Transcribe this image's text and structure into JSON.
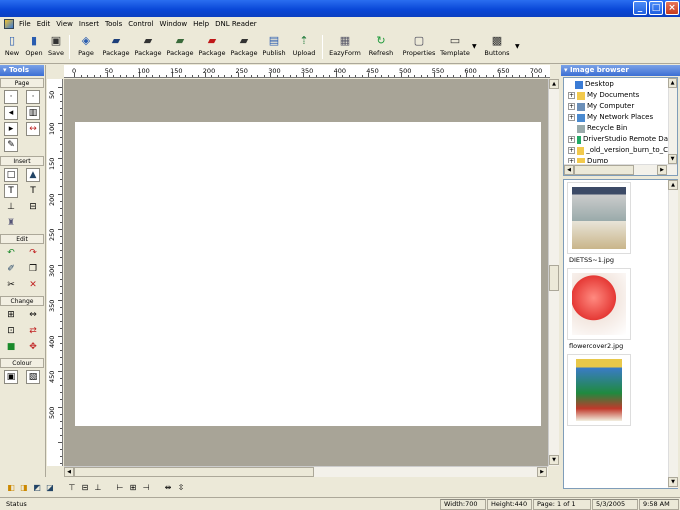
{
  "menu": [
    "File",
    "Edit",
    "View",
    "Insert",
    "Tools",
    "Control",
    "Window",
    "Help",
    "DNL Reader"
  ],
  "toolbar": {
    "items": [
      {
        "label": "New",
        "icon": "new-document-icon"
      },
      {
        "label": "Open",
        "icon": "open-folder-icon"
      },
      {
        "label": "Save",
        "icon": "save-disk-icon"
      },
      {
        "label": "Page",
        "icon": "page-icon"
      },
      {
        "label": "Package",
        "icon": "package-icon"
      },
      {
        "label": "Package",
        "icon": "package-icon"
      },
      {
        "label": "Package",
        "icon": "package-lock-icon"
      },
      {
        "label": "Package",
        "icon": "package-red-lock-icon"
      },
      {
        "label": "Package",
        "icon": "package-icon"
      },
      {
        "label": "Publish",
        "icon": "publish-icon"
      },
      {
        "label": "Upload",
        "icon": "upload-icon"
      },
      {
        "label": "EazyForm",
        "icon": "form-icon"
      },
      {
        "label": "Refresh",
        "icon": "refresh-icon"
      },
      {
        "label": "Properties",
        "icon": "properties-icon"
      },
      {
        "label": "Template",
        "icon": "template-icon"
      },
      {
        "label": "Buttons",
        "icon": "buttons-icon"
      }
    ]
  },
  "tools_panel": {
    "title": "Tools",
    "groups": [
      {
        "label": "Page"
      },
      {
        "label": "Insert"
      },
      {
        "label": "Edit"
      },
      {
        "label": "Change"
      },
      {
        "label": "Colour"
      }
    ]
  },
  "ruler": {
    "h_ticks": [
      "0",
      "50",
      "100",
      "150",
      "200",
      "250",
      "300",
      "350",
      "400",
      "450",
      "500",
      "550",
      "600",
      "650",
      "700"
    ],
    "v_ticks": [
      "50",
      "100",
      "150",
      "200",
      "250",
      "300",
      "350",
      "400",
      "450",
      "500"
    ]
  },
  "image_browser": {
    "title": "Image browser",
    "tree": [
      {
        "label": "Desktop",
        "expander": "",
        "icon": "desktop-icon"
      },
      {
        "label": "My Documents",
        "expander": "+",
        "icon": "folder-icon"
      },
      {
        "label": "My Computer",
        "expander": "+",
        "icon": "computer-icon"
      },
      {
        "label": "My Network Places",
        "expander": "+",
        "icon": "network-icon"
      },
      {
        "label": "Recycle Bin",
        "expander": "",
        "icon": "recycle-bin-icon"
      },
      {
        "label": "DriverStudio Remote Da",
        "expander": "+",
        "icon": "remote-data-icon"
      },
      {
        "label": "_old_version_burn_to_C",
        "expander": "+",
        "icon": "folder-icon"
      },
      {
        "label": "Dump",
        "expander": "+",
        "icon": "folder-icon"
      }
    ],
    "images": [
      {
        "caption": "DIETSS~1.jpg"
      },
      {
        "caption": "flowercover2.jpg"
      },
      {
        "caption": ""
      }
    ]
  },
  "status": {
    "left": "Status",
    "width": "Width:700",
    "height": "Height:440",
    "page": "Page: 1 of 1",
    "date": "5/3/2005",
    "time": "9:58 AM"
  },
  "colors": {
    "titlebar": "#0a48d8",
    "canvas": "#a8a497",
    "panel_header": "#3c6fd4"
  }
}
